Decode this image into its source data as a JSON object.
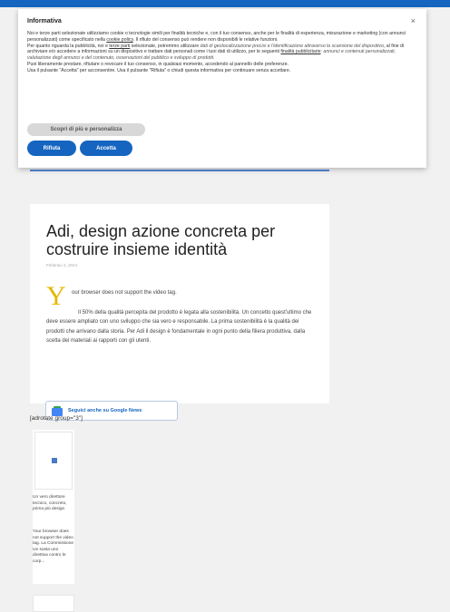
{
  "consent": {
    "title": "Informativa",
    "close": "×",
    "p1": "Noi e terze parti selezionate utilizziamo cookie o tecnologie simili per finalità tecniche e, con il tuo consenso, anche per le finalità di esperienza, misurazione e marketing (con annunci personalizzati) come specificato nella ",
    "p1_link": "cookie policy",
    "p1_end": ". Il rifiuto del consenso può rendere non disponibili le relative funzioni.",
    "p2": "Per quanto riguarda la pubblicità, noi e ",
    "p2_link1": "terze parti",
    "p2_mid": " selezionate, potremmo utilizzare ",
    "p2_italic1": "dati di geolocalizzazione precisi e l'identificazione attraverso la scansione del dispositivo",
    "p2_mid2": ", al fine di archiviare e/o accedere a informazioni su un dispositivo e trattare dati personali come i tuoi dati di utilizzo, per le seguenti ",
    "p2_link2": "finalità pubblicitarie",
    "p2_italic2": ": annunci e contenuti personalizzati, valutazione degli annunci e del contenuto, osservazioni del pubblico e sviluppo di prodotti.",
    "p3": "Puoi liberamente prestare, rifiutare o revocare il tuo consenso, in qualsiasi momento, accedendo al pannello delle preferenze.",
    "p4": "Usa il pulsante \"Accetta\" per acconsentire. Usa il pulsante \"Rifiuta\" o chiudi questa informativa per continuare senza accettare.",
    "customize_label": "Scopri di più e personalizza",
    "reject_label": "Rifiuta",
    "accept_label": "Accetta"
  },
  "article": {
    "title": "Adi, design azione concreta per costruire insieme identità",
    "date": "Febbraio 2, 2024",
    "dropcap": "Y",
    "lead": "our browser does not support the video tag.",
    "body": "Il 50% della qualità percepita del prodotto è legata alla sostenibilità. Un concetto quest'ultimo che deve essere ampliato con uno sviluppo che sia vero e responsabile. La prima sostenibilità è la qualità dei prodotti che arrivano dalla storia. Per Adi il design è fondamentale in ogni punto della filiera produttiva, dalla scelta dei materiali ai rapporti con gli utenti.",
    "gnews_label": "Seguici anche su Google News"
  },
  "adrotate": "[adrotate group=\"3\"]",
  "related": {
    "title": "Un vero direttore tecnico, concreto, prima più design",
    "excerpt": "Your browser does not support the video tag. La Commissione Ue sosta uno direttiva contro le corp..."
  },
  "colors": {
    "accent": "#1565c0",
    "dropcap": "#e5b800"
  },
  "icons": [
    "close-icon",
    "google-news-icon"
  ]
}
